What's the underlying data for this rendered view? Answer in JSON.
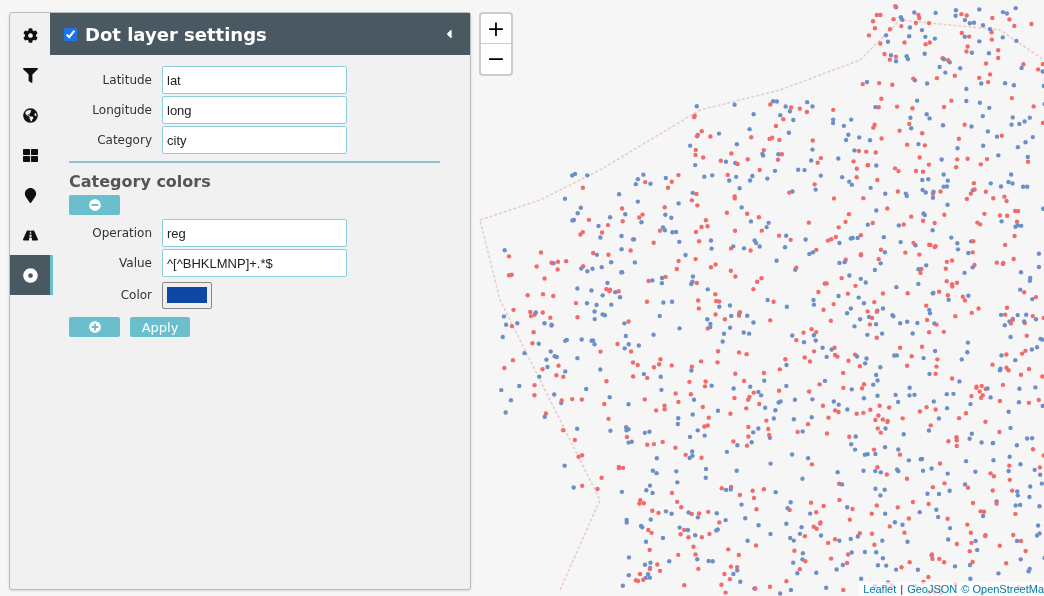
{
  "sidebar": {
    "tabs": [
      {
        "selected": false
      },
      {
        "selected": false
      },
      {
        "selected": false
      },
      {
        "selected": false
      },
      {
        "selected": false
      },
      {
        "selected": false
      },
      {
        "selected": true
      }
    ]
  },
  "panel": {
    "title": "Dot layer settings",
    "enabled": true,
    "fields": [
      {
        "label": "Latitude",
        "value": "lat"
      },
      {
        "label": "Longitude",
        "value": "long"
      },
      {
        "label": "Category",
        "value": "city"
      }
    ],
    "category_colors": {
      "title": "Category colors",
      "rule_fields": [
        {
          "label": "Operation",
          "value": "reg"
        },
        {
          "label": "Value",
          "value": "^[^BHKLMNP]+.*$"
        }
      ],
      "color_label": "Color",
      "color": "#0d47a1"
    },
    "apply_button": "Apply"
  },
  "zoom": {
    "in": "+",
    "out": "−"
  },
  "attribution": {
    "links": [
      "Leaflet",
      "GeoJSON"
    ],
    "separator": "|",
    "credit": "© OpenStreetMa"
  }
}
